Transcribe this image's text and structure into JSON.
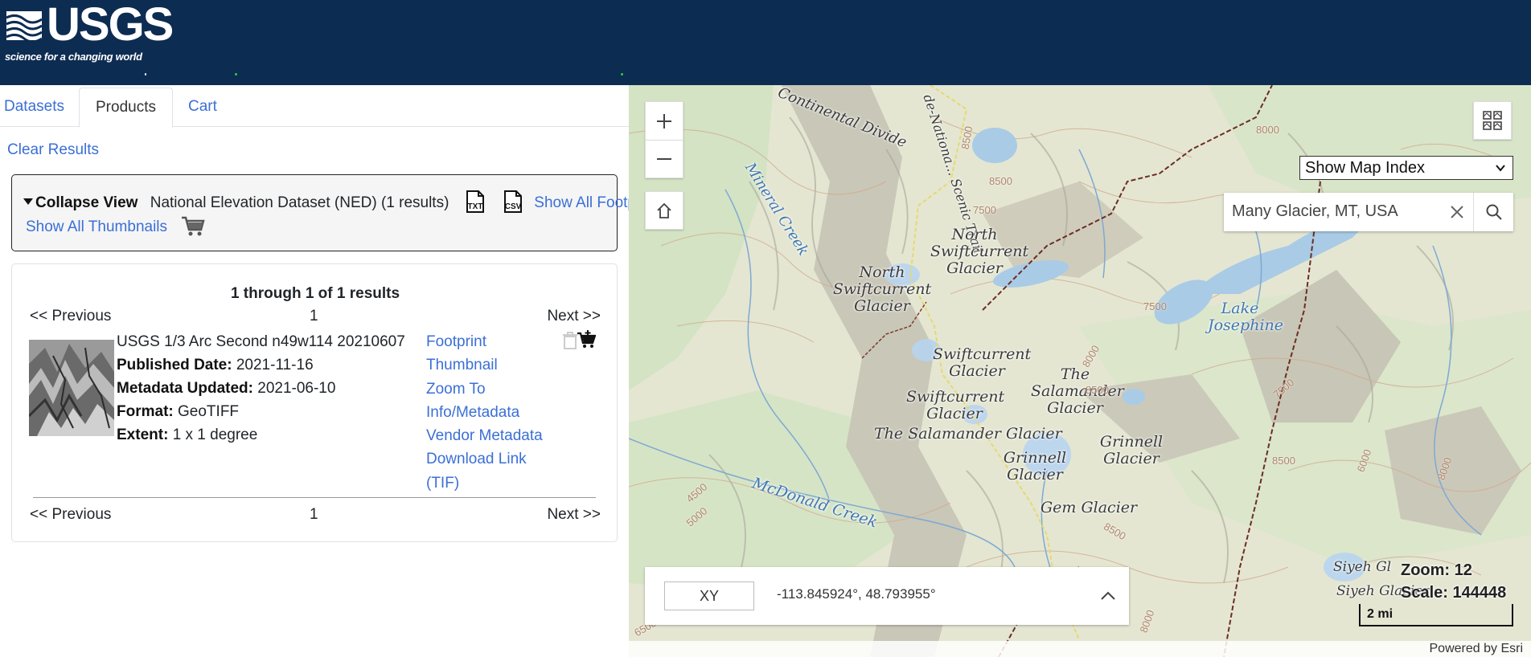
{
  "header": {
    "logo_text": "USGS",
    "logo_tagline": "science for a changing world",
    "background_color": "#0d2c52"
  },
  "tabs": [
    {
      "label": "Datasets",
      "active": false
    },
    {
      "label": "Products",
      "active": true
    },
    {
      "label": "Cart",
      "active": false
    }
  ],
  "clear_results_label": "Clear Results",
  "collapse_view": {
    "label": "Collapse View",
    "dataset_title": "National Elevation Dataset (NED) (1 results)",
    "txt_icon": "txt-file-icon",
    "csv_icon": "csv-file-icon",
    "show_all_footprints_label": "Show All Footprints",
    "show_all_thumbnails_label": "Show All Thumbnails",
    "cart_icon": "shopping-cart-icon"
  },
  "results": {
    "count_text": "1 through 1 of 1 results",
    "previous_label": "<< Previous",
    "page_number": "1",
    "next_label": "Next >>",
    "item": {
      "title": "USGS 1/3 Arc Second n49w114 20210607",
      "published_label": "Published Date:",
      "published_value": "2021-11-16",
      "metadata_updated_label": "Metadata Updated:",
      "metadata_updated_value": "2021-06-10",
      "format_label": "Format:",
      "format_value": "GeoTIFF",
      "extent_label": "Extent:",
      "extent_value": "1 x 1 degree",
      "actions": [
        "Footprint",
        "Thumbnail",
        "Zoom To",
        "Info/Metadata",
        "Vendor Metadata",
        "Download Link",
        "(TIF)"
      ]
    }
  },
  "map": {
    "map_index_select": "Show Map Index",
    "search_value": "Many Glacier, MT, USA",
    "coord_mode": "XY",
    "coordinates": "-113.845924°, 48.793955°",
    "zoom_label": "Zoom: 12",
    "scale_label": "Scale: 144448",
    "scalebar_label": "2 mi",
    "attribution": "Powered by Esri",
    "labels": {
      "continental_divide": "Continental Divide",
      "national_scenic_trail": "de-Nationa... Scenic Trail",
      "mineral_creek": "Mineral Creek",
      "north_swiftcurrent_glacier_1": "North Swiftcurrent Glacier",
      "north_swiftcurrent_glacier_2": "North Swiftcurrent Glacier",
      "swiftcurrent_glacier_1": "Swiftcurrent Glacier",
      "swiftcurrent_glacier_2": "Swiftcurrent Glacier",
      "the_salamander_glacier_1": "The Salamander Glacier",
      "the_salamander_glacier_2": "The Salamander Glacier",
      "lake_josephine": "Lake Josephine",
      "grinnell_glacier_1": "Grinnell Glacier",
      "grinnell_glacier_2": "Grinnell Glacier",
      "gem_glacier": "Gem Glacier",
      "mcdonald_creek": "McDonald Creek",
      "siyeh_glacier_1": "Siyeh Gl",
      "siyeh_glacier_2": "Siyeh Glacier"
    },
    "contours": [
      "8500",
      "8500",
      "7500",
      "7500",
      "8000",
      "8500",
      "7500",
      "8000",
      "4500",
      "5000",
      "8500",
      "6000",
      "8000",
      "8500",
      "6500",
      "8000"
    ]
  }
}
